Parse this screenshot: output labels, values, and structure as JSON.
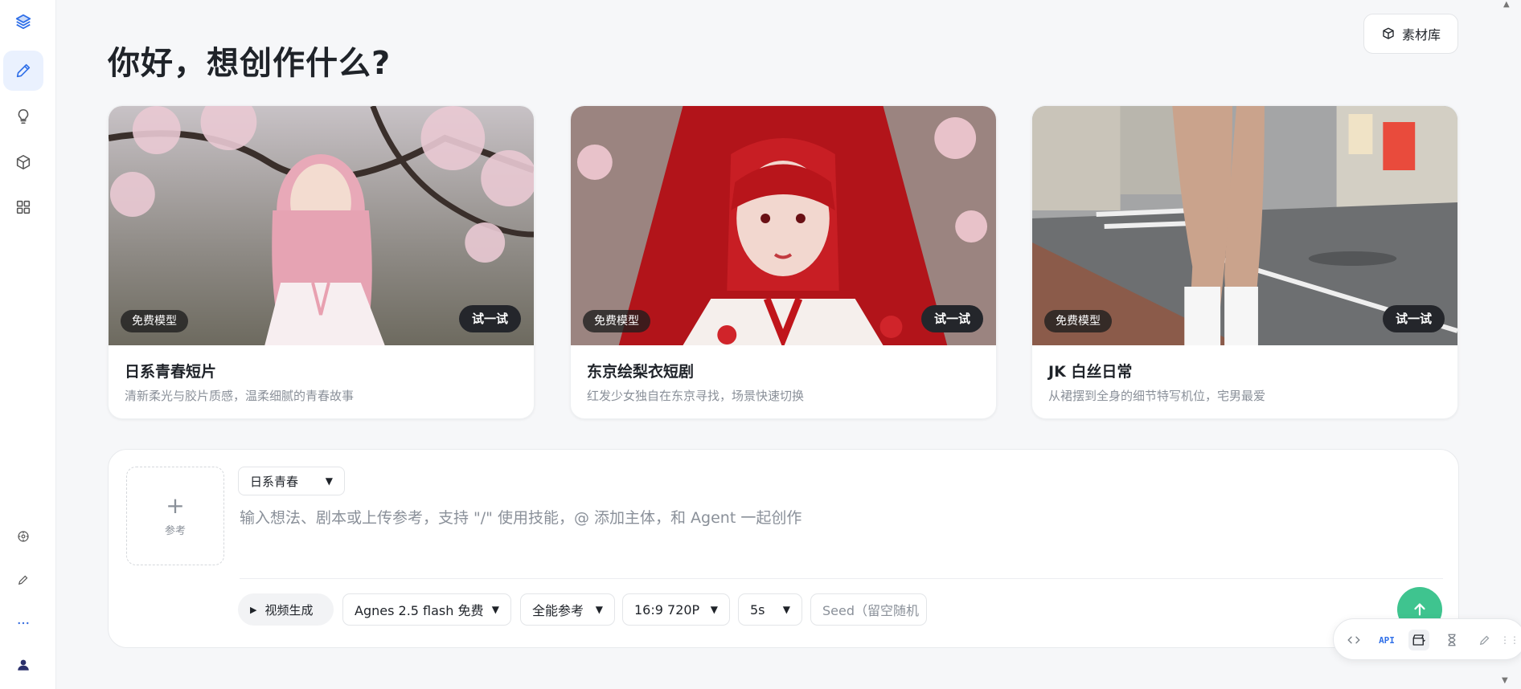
{
  "sidebar": {
    "items": [
      {
        "icon": "layers-logo-icon"
      },
      {
        "icon": "pencil-icon",
        "active": true
      },
      {
        "icon": "lightbulb-icon"
      },
      {
        "icon": "cube-icon"
      },
      {
        "icon": "apps-grid-icon"
      }
    ],
    "bottom_items": [
      {
        "icon": "compass-icon"
      },
      {
        "icon": "edit-icon"
      },
      {
        "icon": "more-dots-icon"
      },
      {
        "icon": "user-avatar-icon"
      }
    ]
  },
  "header": {
    "title": "你好，想创作什么?",
    "library_button": "素材库",
    "library_icon": "box-icon"
  },
  "cards": [
    {
      "badge": "免费模型",
      "try_label": "试一试",
      "title": "日系青春短片",
      "desc": "清新柔光与胶片质感，温柔细腻的青春故事"
    },
    {
      "badge": "免费模型",
      "try_label": "试一试",
      "title": "东京绘梨衣短剧",
      "desc": "红发少女独自在东京寻找，场景快速切换"
    },
    {
      "badge": "免费模型",
      "try_label": "试一试",
      "title": "JK 白丝日常",
      "desc": "从裙摆到全身的细节特写机位，宅男最爱"
    }
  ],
  "composer": {
    "reference_label": "参考",
    "style_select": "日系青春",
    "prompt_placeholder": "输入想法、剧本或上传参考，支持 \"/\" 使用技能，@ 添加主体，和 Agent 一起创作",
    "mode_label": "视频生成",
    "model_select": "Agnes 2.5 flash 免费",
    "reference_mode": "全能参考",
    "ratio_resolution": "16:9 720P",
    "duration": "5s",
    "seed_placeholder": "Seed（留空随机"
  },
  "float_toolbar": {
    "items": [
      "code-icon",
      "API",
      "clapper-icon",
      "hourglass-icon",
      "pen-icon"
    ],
    "api_label": "API"
  },
  "colors": {
    "accent_blue": "#2f6fe8",
    "send_green": "#3fc48f",
    "card_title": "#1f2329",
    "muted": "#8a9099"
  }
}
